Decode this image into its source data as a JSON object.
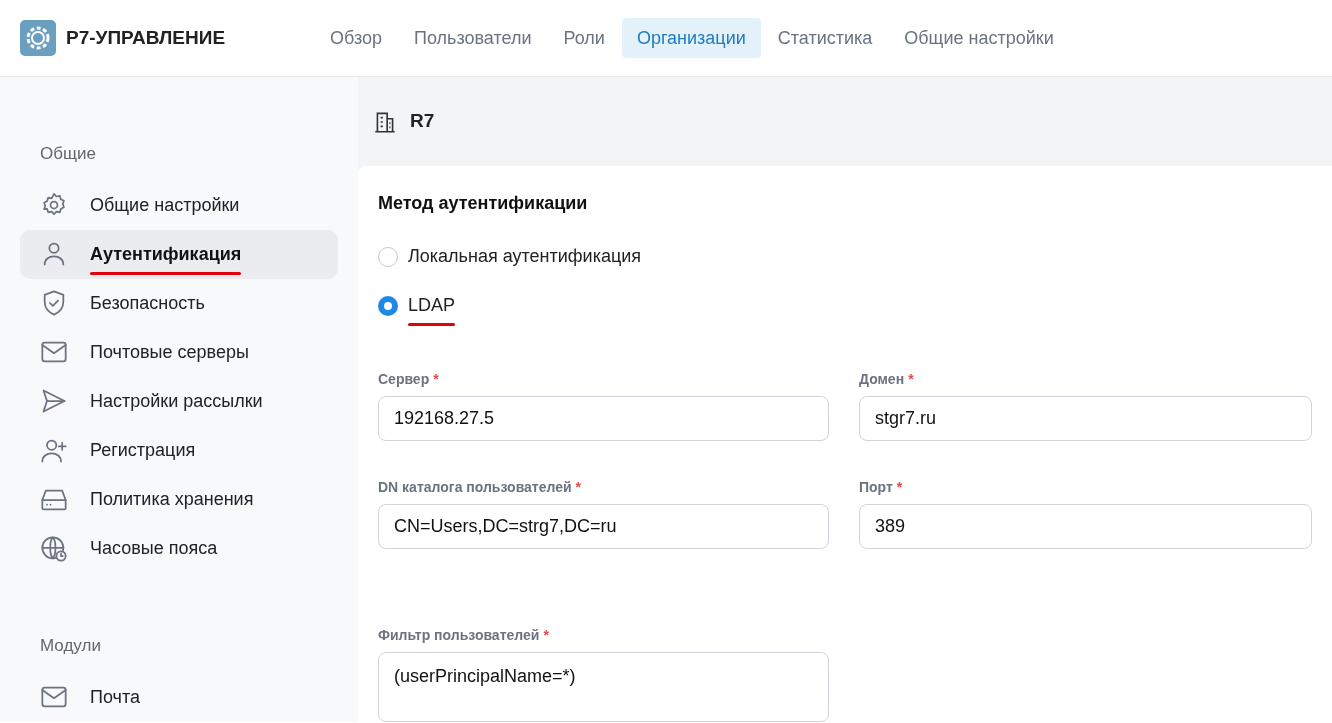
{
  "header": {
    "logo_text": "Р7-УПРАВЛЕНИЕ",
    "tabs": [
      {
        "label": "Обзор",
        "selected": false
      },
      {
        "label": "Пользователи",
        "selected": false
      },
      {
        "label": "Роли",
        "selected": false
      },
      {
        "label": "Организации",
        "selected": true
      },
      {
        "label": "Статистика",
        "selected": false
      },
      {
        "label": "Общие настройки",
        "selected": false
      }
    ]
  },
  "sidebar": {
    "sections": [
      {
        "title": "Общие",
        "items": [
          {
            "label": "Общие настройки",
            "kind": "gear",
            "selected": false,
            "annotated": false
          },
          {
            "label": "Аутентификация",
            "kind": "user",
            "selected": true,
            "annotated": true
          },
          {
            "label": "Безопасность",
            "kind": "shield",
            "selected": false,
            "annotated": false
          },
          {
            "label": "Почтовые серверы",
            "kind": "mail",
            "selected": false,
            "annotated": false
          },
          {
            "label": "Настройки рассылки",
            "kind": "send",
            "selected": false,
            "annotated": false
          },
          {
            "label": "Регистрация",
            "kind": "user-plus",
            "selected": false,
            "annotated": false
          },
          {
            "label": "Политика хранения",
            "kind": "drive",
            "selected": false,
            "annotated": false
          },
          {
            "label": "Часовые пояса",
            "kind": "globe-clock",
            "selected": false,
            "annotated": false
          }
        ]
      },
      {
        "title": "Модули",
        "items": [
          {
            "label": "Почта",
            "kind": "mail",
            "selected": false,
            "annotated": false
          }
        ]
      }
    ]
  },
  "organization": {
    "name": "R7"
  },
  "auth": {
    "title": "Метод аутентификации",
    "options": [
      {
        "label": "Локальная аутентификация",
        "selected": false,
        "annotated": false
      },
      {
        "label": "LDAP",
        "selected": true,
        "annotated": true
      }
    ],
    "rows": [
      [
        {
          "kind": "input",
          "label": "Сервер",
          "required_mark": "*",
          "value": "192168.27.5"
        },
        {
          "kind": "input",
          "label": "Домен",
          "required_mark": "*",
          "value": "stgr7.ru"
        }
      ],
      [
        {
          "kind": "input",
          "label": "DN каталога пользователей",
          "required_mark": "*",
          "value": "CN=Users,DC=strg7,DC=ru"
        },
        {
          "kind": "input",
          "label": "Порт",
          "required_mark": "*",
          "value": "389"
        }
      ],
      [
        {
          "kind": "textarea",
          "label": "Фильтр пользователей",
          "required_mark": "*",
          "value": "(userPrincipalName=*)"
        }
      ]
    ]
  }
}
